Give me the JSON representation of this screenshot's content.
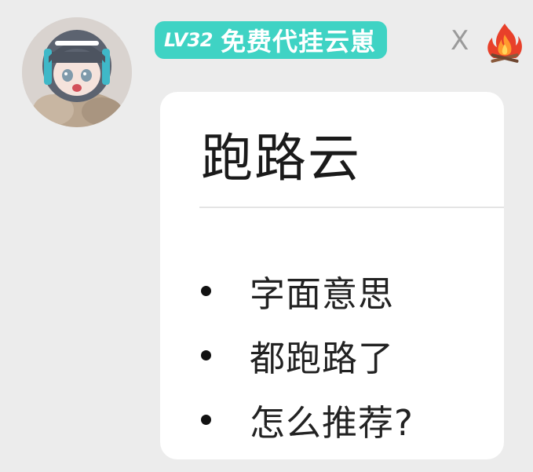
{
  "sender": {
    "level": "LV32",
    "name": "免费代挂云崽",
    "separator": "X",
    "fire_icon": "fire-icon"
  },
  "message": {
    "heading": "跑路云",
    "items": [
      "字面意思",
      "都跑路了",
      "怎么推荐?"
    ]
  },
  "colors": {
    "badge": "#3fd3c4",
    "background": "#ececec",
    "card": "#ffffff"
  }
}
